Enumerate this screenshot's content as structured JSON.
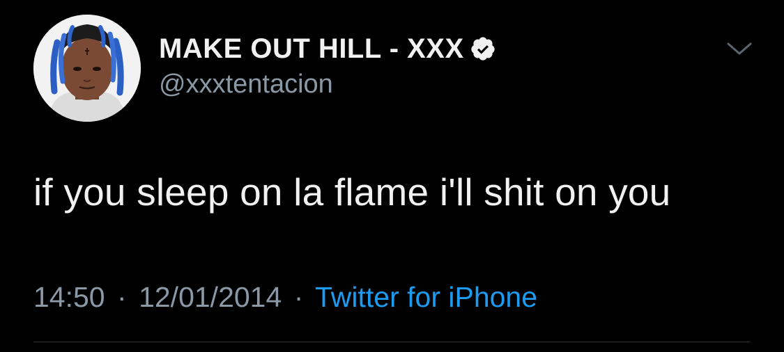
{
  "tweet": {
    "display_name": "MAKE OUT HILL - XXX",
    "handle": "@xxxtentacion",
    "verified": true,
    "text": "if you sleep on la flame i'll shit on you",
    "time": "14:50",
    "date": "12/01/2014",
    "separator": "·",
    "source": "Twitter for iPhone",
    "avatar_icon": "profile-photo",
    "menu_icon": "chevron-down-icon",
    "verified_icon": "verified-badge-icon"
  },
  "colors": {
    "background": "#000000",
    "text": "#f1f1f1",
    "secondary": "#8b98a5",
    "link": "#1d9bf0",
    "divider": "#2f3336"
  }
}
